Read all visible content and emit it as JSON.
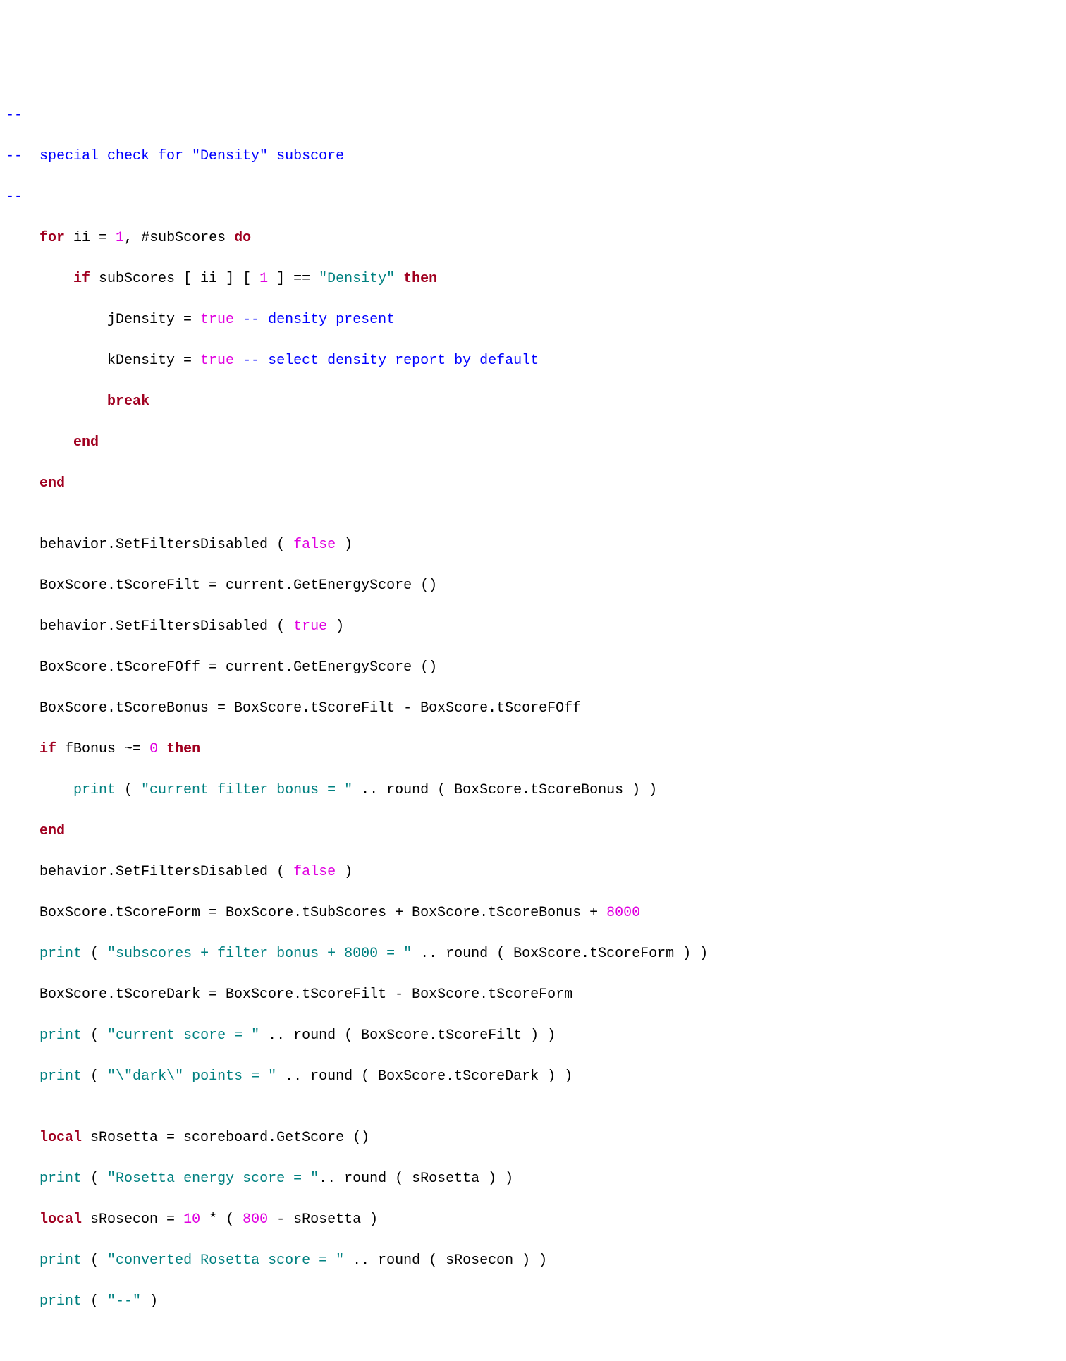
{
  "code": {
    "l1": {
      "a": "--"
    },
    "l2": {
      "a": "--  special check for \"Density\" subscore"
    },
    "l3": {
      "a": "--"
    },
    "l4": {
      "a": "    ",
      "b": "for",
      "c": " ii = ",
      "d": "1",
      "e": ", #subScores ",
      "f": "do"
    },
    "l5": {
      "a": "        ",
      "b": "if",
      "c": " subScores [ ii ] [ ",
      "d": "1",
      "e": " ] == ",
      "f": "\"Density\"",
      "g": " ",
      "h": "then"
    },
    "l6": {
      "a": "            jDensity = ",
      "b": "true",
      "c": " ",
      "d": "-- density present"
    },
    "l7": {
      "a": "            kDensity = ",
      "b": "true",
      "c": " ",
      "d": "-- select density report by default"
    },
    "l8": {
      "a": "            ",
      "b": "break"
    },
    "l9": {
      "a": "        ",
      "b": "end"
    },
    "l10": {
      "a": "    ",
      "b": "end"
    },
    "l11": {
      "a": ""
    },
    "l12": {
      "a": "    behavior.SetFiltersDisabled ( ",
      "b": "false",
      "c": " )"
    },
    "l13": {
      "a": "    BoxScore.tScoreFilt = current.GetEnergyScore ()"
    },
    "l14": {
      "a": "    behavior.SetFiltersDisabled ( ",
      "b": "true",
      "c": " )"
    },
    "l15": {
      "a": "    BoxScore.tScoreFOff = current.GetEnergyScore ()"
    },
    "l16": {
      "a": "    BoxScore.tScoreBonus = BoxScore.tScoreFilt - BoxScore.tScoreFOff"
    },
    "l17": {
      "a": "    ",
      "b": "if",
      "c": " fBonus ~= ",
      "d": "0",
      "e": " ",
      "f": "then"
    },
    "l18": {
      "a": "        ",
      "b": "print",
      "c": " ( ",
      "d": "\"current filter bonus = \"",
      "e": " .. round ( BoxScore.tScoreBonus ) )"
    },
    "l19": {
      "a": "    ",
      "b": "end"
    },
    "l20": {
      "a": "    behavior.SetFiltersDisabled ( ",
      "b": "false",
      "c": " )"
    },
    "l21": {
      "a": "    BoxScore.tScoreForm = BoxScore.tSubScores + BoxScore.tScoreBonus + ",
      "b": "8000"
    },
    "l22": {
      "a": "    ",
      "b": "print",
      "c": " ( ",
      "d": "\"subscores + filter bonus + 8000 = \"",
      "e": " .. round ( BoxScore.tScoreForm ) )"
    },
    "l23": {
      "a": "    BoxScore.tScoreDark = BoxScore.tScoreFilt - BoxScore.tScoreForm "
    },
    "l24": {
      "a": "    ",
      "b": "print",
      "c": " ( ",
      "d": "\"current score = \"",
      "e": " .. round ( BoxScore.tScoreFilt ) )"
    },
    "l25": {
      "a": "    ",
      "b": "print",
      "c": " ( ",
      "d": "\"\\\"dark\\\" points = \"",
      "e": " .. round ( BoxScore.tScoreDark ) )"
    },
    "l26": {
      "a": ""
    },
    "l27": {
      "a": "    ",
      "b": "local",
      "c": " sRosetta = scoreboard.GetScore ()"
    },
    "l28": {
      "a": "    ",
      "b": "print",
      "c": " ( ",
      "d": "\"Rosetta energy score = \"",
      "e": ".. round ( sRosetta ) )"
    },
    "l29": {
      "a": "    ",
      "b": "local",
      "c": " sRosecon = ",
      "d": "10",
      "e": " * ( ",
      "f": "800",
      "g": " - sRosetta )"
    },
    "l30": {
      "a": "    ",
      "b": "print",
      "c": " ( ",
      "d": "\"converted Rosetta score = \"",
      "e": " .. round ( sRosecon ) )"
    },
    "l31": {
      "a": "    ",
      "b": "print",
      "c": " ( ",
      "d": "\"--\"",
      "e": " )"
    }
  }
}
